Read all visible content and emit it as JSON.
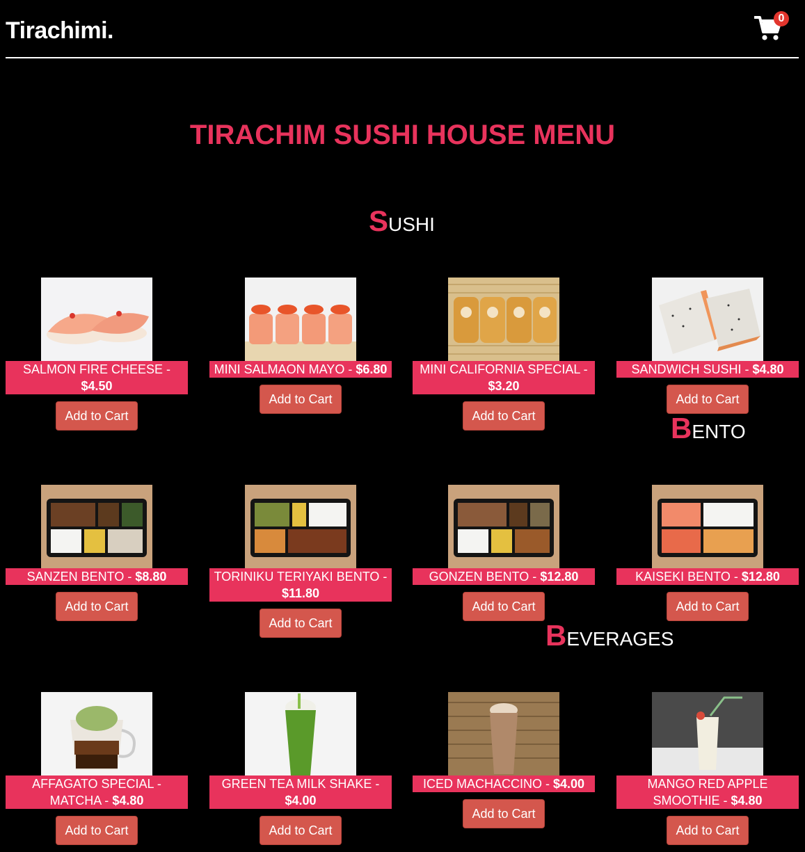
{
  "header": {
    "brand": "Tirachimi.",
    "cart_count": "0"
  },
  "page_title": "TIRACHIM SUSHI HOUSE MENU",
  "sections": {
    "sushi": {
      "cap": "S",
      "rest": "USHI"
    },
    "bento": {
      "cap": "B",
      "rest": "ENTO"
    },
    "beverages": {
      "cap": "B",
      "rest": "EVERAGES"
    }
  },
  "button_label": "Add to Cart",
  "sushi_items": [
    {
      "name": "SALMON FIRE CHEESE - ",
      "price": "$4.50",
      "image": "salmon-nigiri"
    },
    {
      "name": "MINI SALMAON MAYO - ",
      "price": "$6.80",
      "image": "salmon-roll"
    },
    {
      "name": "MINI CALIFORNIA SPECIAL - ",
      "price": "$3.20",
      "image": "california-roll"
    },
    {
      "name": "SANDWICH SUSHI - ",
      "price": "$4.80",
      "image": "sandwich-sushi"
    }
  ],
  "bento_items": [
    {
      "name": "SANZEN BENTO - ",
      "price": "$8.80",
      "image": "bento-box"
    },
    {
      "name": "TORINIKU TERIYAKI BENTO - ",
      "price": "$11.80",
      "image": "bento-box"
    },
    {
      "name": "GONZEN BENTO - ",
      "price": "$12.80",
      "image": "bento-box"
    },
    {
      "name": "KAISEKI BENTO - ",
      "price": "$12.80",
      "image": "bento-box"
    }
  ],
  "beverage_items": [
    {
      "name": "AFFAGATO SPECIAL - MATCHA - ",
      "price": "$4.80",
      "image": "affogato-cup"
    },
    {
      "name": "GREEN TEA MILK SHAKE - ",
      "price": "$4.00",
      "image": "green-shake"
    },
    {
      "name": "ICED MACHACCINO - ",
      "price": "$4.00",
      "image": "iced-mocha"
    },
    {
      "name": "MANGO RED APPLE SMOOTHIE - ",
      "price": "$4.80",
      "image": "smoothie"
    }
  ],
  "colors": {
    "accent": "#e8335c",
    "button": "#d4574d",
    "background": "#000000",
    "badge": "#e2352d"
  }
}
